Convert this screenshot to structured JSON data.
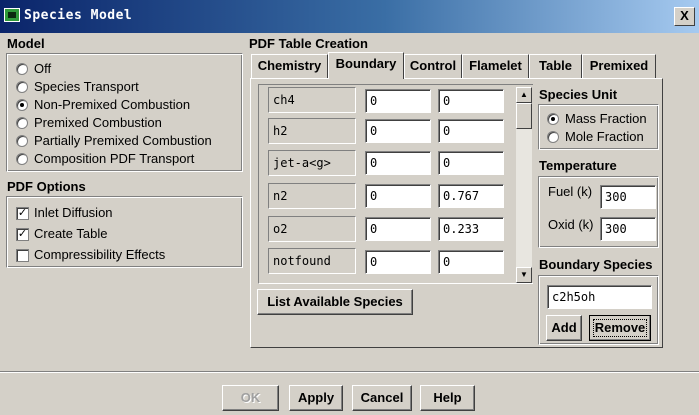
{
  "window": {
    "title": "Species Model",
    "close_label": "X"
  },
  "model": {
    "label": "Model",
    "options": [
      {
        "label": "Off",
        "selected": false
      },
      {
        "label": "Species Transport",
        "selected": false
      },
      {
        "label": "Non-Premixed Combustion",
        "selected": true
      },
      {
        "label": "Premixed Combustion",
        "selected": false
      },
      {
        "label": "Partially Premixed Combustion",
        "selected": false
      },
      {
        "label": "Composition PDF Transport",
        "selected": false
      }
    ]
  },
  "pdf_options": {
    "label": "PDF Options",
    "options": [
      {
        "label": "Inlet Diffusion",
        "checked": true
      },
      {
        "label": "Create Table",
        "checked": true
      },
      {
        "label": "Compressibility Effects",
        "checked": false
      }
    ]
  },
  "pdf_table": {
    "label": "PDF Table Creation",
    "tabs": [
      "Chemistry",
      "Boundary",
      "Control",
      "Flamelet",
      "Table",
      "Premixed"
    ],
    "active_tab": "Boundary",
    "species": [
      {
        "name": "ch4",
        "fuel": "0",
        "oxid": "0"
      },
      {
        "name": "h2",
        "fuel": "0",
        "oxid": "0"
      },
      {
        "name": "jet-a<g>",
        "fuel": "0",
        "oxid": "0"
      },
      {
        "name": "n2",
        "fuel": "0",
        "oxid": "0.767"
      },
      {
        "name": "o2",
        "fuel": "0",
        "oxid": "0.233"
      },
      {
        "name": "notfound",
        "fuel": "0",
        "oxid": "0"
      }
    ],
    "list_button": "List Available Species"
  },
  "species_unit": {
    "label": "Species Unit",
    "options": [
      {
        "label": "Mass Fraction",
        "selected": true
      },
      {
        "label": "Mole Fraction",
        "selected": false
      }
    ]
  },
  "temperature": {
    "label": "Temperature",
    "fuel_label": "Fuel (k)",
    "fuel_value": "300",
    "oxid_label": "Oxid (k)",
    "oxid_value": "300"
  },
  "boundary_species": {
    "label": "Boundary Species",
    "value": "c2h5oh",
    "add_label": "Add",
    "remove_label": "Remove"
  },
  "footer": {
    "ok": "OK",
    "apply": "Apply",
    "cancel": "Cancel",
    "help": "Help"
  }
}
